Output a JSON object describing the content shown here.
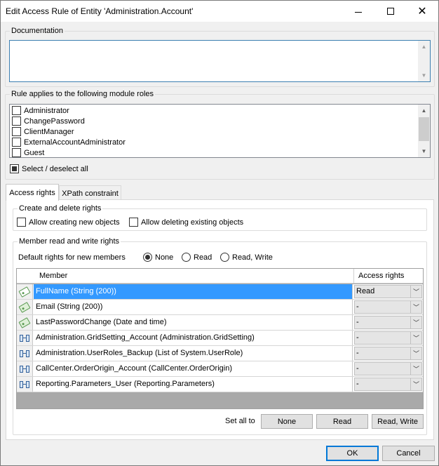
{
  "window": {
    "title": "Edit Access Rule of Entity 'Administration.Account'"
  },
  "documentation": {
    "label": "Documentation",
    "value": ""
  },
  "module_roles": {
    "label": "Rule applies to the following module roles",
    "items": [
      {
        "label": "Administrator",
        "checked": false
      },
      {
        "label": "ChangePassword",
        "checked": false
      },
      {
        "label": "ClientManager",
        "checked": false
      },
      {
        "label": "ExternalAccountAdministrator",
        "checked": false
      },
      {
        "label": "Guest",
        "checked": false
      }
    ],
    "select_all_label": "Select / deselect all"
  },
  "tabs": [
    {
      "label": "Access rights",
      "active": true
    },
    {
      "label": "XPath constraint",
      "active": false
    }
  ],
  "create_delete": {
    "label": "Create and delete rights",
    "allow_create_label": "Allow creating new objects",
    "allow_delete_label": "Allow deleting existing objects"
  },
  "member_rights": {
    "label": "Member read and write rights",
    "default_label": "Default rights for new members",
    "options": [
      "None",
      "Read",
      "Read, Write"
    ],
    "selected": "None"
  },
  "grid": {
    "columns": [
      "Member",
      "Access rights"
    ],
    "rows": [
      {
        "member": "FullName (String (200))",
        "access": "Read",
        "kind": "attribute",
        "selected": true
      },
      {
        "member": "Email (String (200))",
        "access": "-",
        "kind": "attribute",
        "selected": false
      },
      {
        "member": "LastPasswordChange (Date and time)",
        "access": "-",
        "kind": "attribute",
        "selected": false
      },
      {
        "member": "Administration.GridSetting_Account (Administration.GridSetting)",
        "access": "-",
        "kind": "association",
        "selected": false
      },
      {
        "member": "Administration.UserRoles_Backup (List of System.UserRole)",
        "access": "-",
        "kind": "association",
        "selected": false
      },
      {
        "member": "CallCenter.OrderOrigin_Account (CallCenter.OrderOrigin)",
        "access": "-",
        "kind": "association",
        "selected": false
      },
      {
        "member": "Reporting.Parameters_User (Reporting.Parameters)",
        "access": "-",
        "kind": "association",
        "selected": false
      }
    ]
  },
  "set_all": {
    "label": "Set all to",
    "none": "None",
    "read": "Read",
    "read_write": "Read, Write"
  },
  "footer": {
    "ok": "OK",
    "cancel": "Cancel"
  },
  "colors": {
    "selection": "#3399ff",
    "focus_border": "#0078d7",
    "grid_background": "#a9a9a9"
  }
}
